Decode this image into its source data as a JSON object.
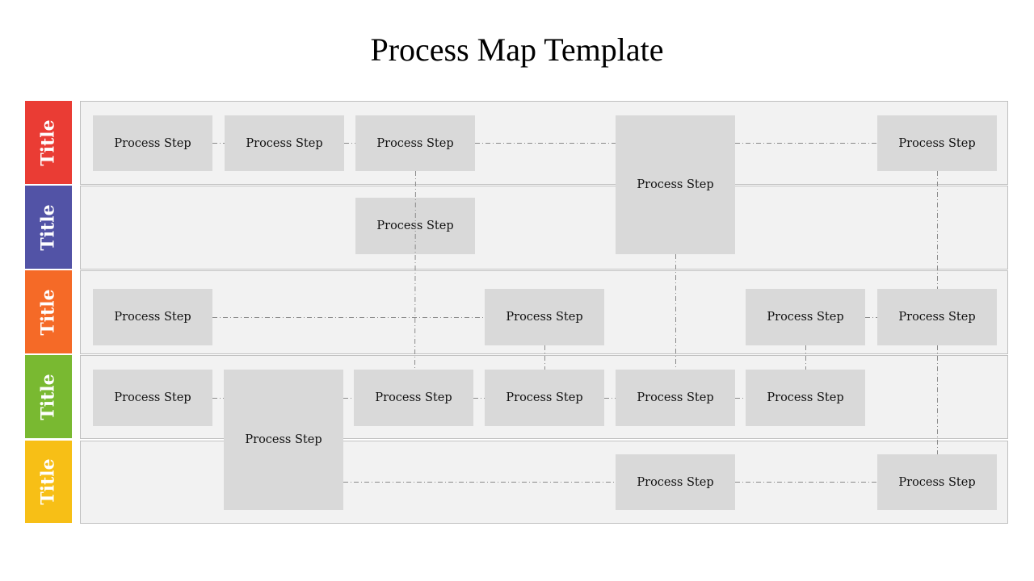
{
  "title": "Process Map Template",
  "lanes": [
    {
      "label": "Title",
      "color": "#ea3c34"
    },
    {
      "label": "Title",
      "color": "#5253a6"
    },
    {
      "label": "Title",
      "color": "#f56a27"
    },
    {
      "label": "Title",
      "color": "#79b931"
    },
    {
      "label": "Title",
      "color": "#f7bf16"
    }
  ],
  "steps": [
    {
      "id": "s1",
      "label": "Process Step"
    },
    {
      "id": "s2",
      "label": "Process Step"
    },
    {
      "id": "s3",
      "label": "Process Step"
    },
    {
      "id": "s4",
      "label": "Process Step"
    },
    {
      "id": "s5",
      "label": "Process Step"
    },
    {
      "id": "s6",
      "label": "Process Step"
    },
    {
      "id": "s7",
      "label": "Process Step"
    },
    {
      "id": "s8",
      "label": "Process Step"
    },
    {
      "id": "s9",
      "label": "Process Step"
    },
    {
      "id": "s10",
      "label": "Process Step"
    },
    {
      "id": "s11",
      "label": "Process Step"
    },
    {
      "id": "s12",
      "label": "Process Step"
    },
    {
      "id": "s13",
      "label": "Process Step"
    },
    {
      "id": "s14",
      "label": "Process Step"
    },
    {
      "id": "s15",
      "label": "Process Step"
    },
    {
      "id": "s16",
      "label": "Process Step"
    },
    {
      "id": "s17",
      "label": "Process Step"
    },
    {
      "id": "s18",
      "label": "Process Step"
    }
  ],
  "connector_color": "#8a8a8a",
  "box_color": "#d9d9d9",
  "lane_fill": "#f2f2f2"
}
